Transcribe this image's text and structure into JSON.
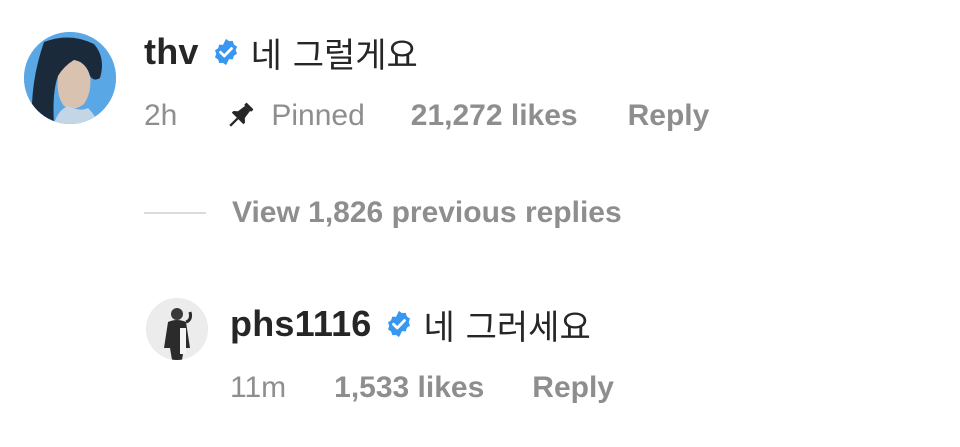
{
  "comments": [
    {
      "username": "thv",
      "text": "네 그럴게요",
      "time": "2h",
      "pinned_label": "Pinned",
      "likes": "21,272 likes",
      "reply_label": "Reply"
    }
  ],
  "view_replies_label": "View 1,826 previous replies",
  "replies": [
    {
      "username": "phs1116",
      "text": "네 그러세요",
      "time": "11m",
      "likes": "1,533 likes",
      "reply_label": "Reply"
    }
  ],
  "colors": {
    "verified": "#3897f0",
    "secondary_text": "#8e8e8e",
    "primary_text": "#262626",
    "thread_line": "#dbdbdb"
  },
  "icons": [
    "verified-badge-icon",
    "pin-icon"
  ]
}
